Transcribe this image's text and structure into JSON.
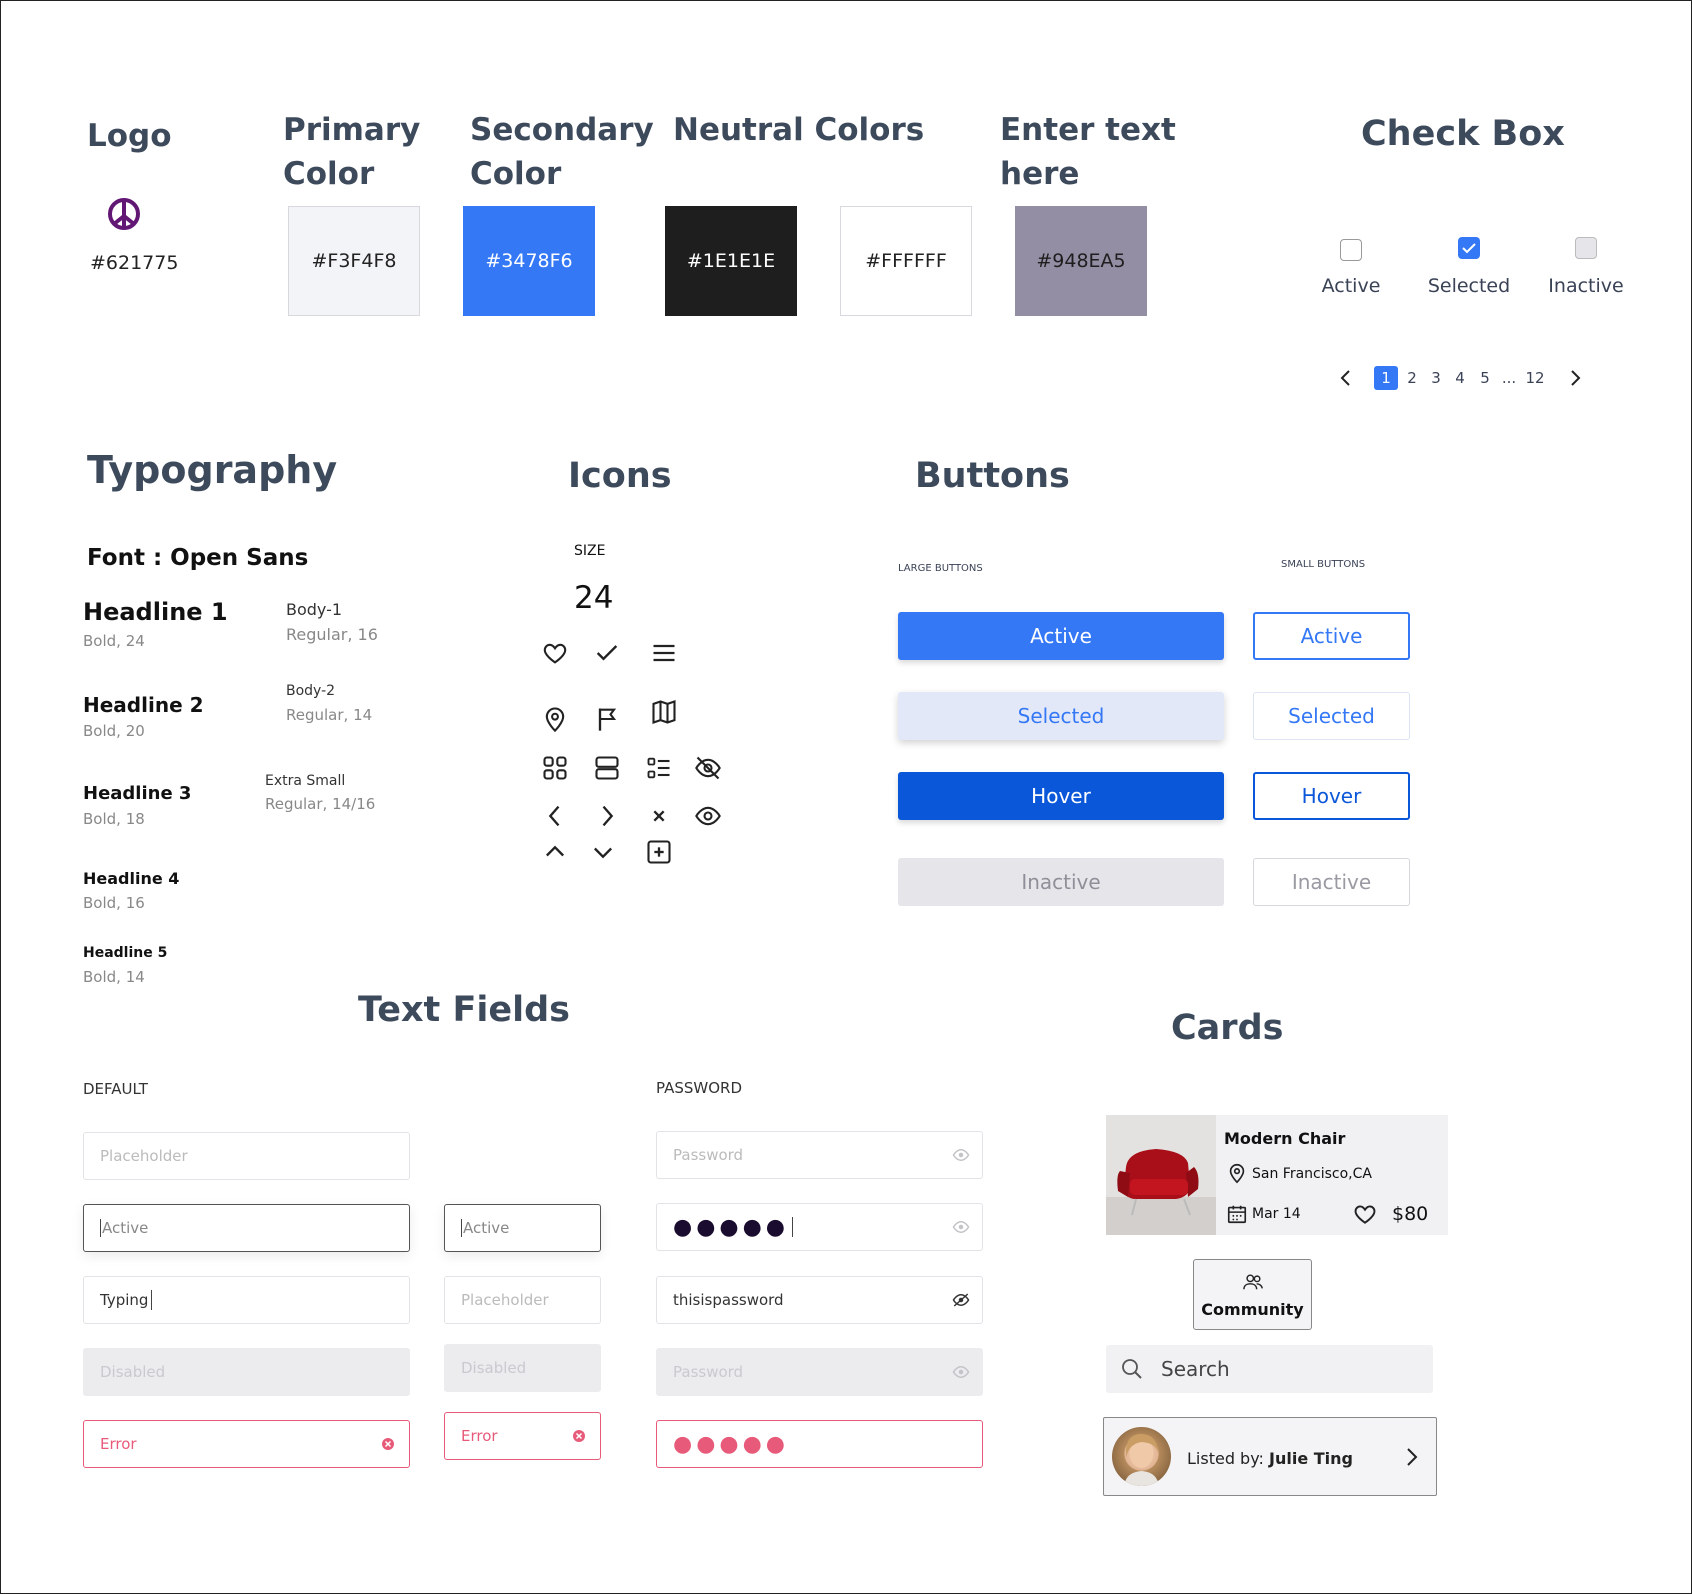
{
  "colors": {
    "logo": "#621775",
    "primary": "#F3F4F8",
    "secondary": "#3478F6",
    "neutral_dark": "#1E1E1E",
    "neutral_light": "#FFFFFF",
    "muted": "#948EA5",
    "button_hover": "#0B57D9",
    "button_selected_bg": "#E3E8F8",
    "error": "#E85A7A"
  },
  "logo": {
    "title": "Logo",
    "icon": "peace-icon",
    "hex": "#621775"
  },
  "primary": {
    "title_line1": "Primary",
    "title_line2": "Color",
    "hex": "#F3F4F8"
  },
  "secondary": {
    "title_line1": "Secondary",
    "title_line2": "Color",
    "hex": "#3478F6"
  },
  "neutral": {
    "title": "Neutral Colors",
    "hex_dark": "#1E1E1E",
    "hex_light": "#FFFFFF"
  },
  "extra": {
    "title_line1": "Enter text",
    "title_line2": "here",
    "hex": "#948EA5"
  },
  "checkbox": {
    "title": "Check Box",
    "items": [
      {
        "label": "Active"
      },
      {
        "label": "Selected"
      },
      {
        "label": "Inactive"
      }
    ]
  },
  "pagination": {
    "pages": [
      "1",
      "2",
      "3",
      "4",
      "5"
    ],
    "ellipsis": "...",
    "last": "12",
    "current": "1"
  },
  "typography": {
    "title": "Typography",
    "font": "Font : Open Sans",
    "headlines": [
      {
        "name": "Headline 1",
        "spec": "Bold, 24"
      },
      {
        "name": "Headline 2",
        "spec": "Bold, 20"
      },
      {
        "name": "Headline 3",
        "spec": "Bold, 18"
      },
      {
        "name": "Headline 4",
        "spec": "Bold, 16"
      },
      {
        "name": "Headline 5",
        "spec": "Bold, 14"
      }
    ],
    "bodies": [
      {
        "name": "Body-1",
        "spec": "Regular, 16"
      },
      {
        "name": "Body-2",
        "spec": "Regular, 14"
      },
      {
        "name": "Extra Small",
        "spec": "Regular, 14/16"
      }
    ]
  },
  "icons": {
    "title": "Icons",
    "size_label": "SIZE",
    "size_value": "24",
    "names": [
      "heart-icon",
      "check-icon",
      "menu-icon",
      "location-pin-icon",
      "flag-icon",
      "map-icon",
      "grid-icon",
      "rows-icon",
      "list-icon",
      "eye-off-icon",
      "chevron-left-icon",
      "chevron-right-icon",
      "close-icon",
      "eye-icon",
      "chevron-up-icon",
      "chevron-down-icon",
      "plus-square-icon"
    ]
  },
  "buttons": {
    "title": "Buttons",
    "large_label": "LARGE BUTTONS",
    "small_label": "SMALL BUTTONS",
    "states": [
      "Active",
      "Selected",
      "Hover",
      "Inactive"
    ]
  },
  "text_fields": {
    "title": "Text Fields",
    "default_label": "DEFAULT",
    "password_label": "PASSWORD",
    "placeholder": "Placeholder",
    "active": "Active",
    "typing": "Typing",
    "disabled": "Disabled",
    "error": "Error",
    "password_placeholder": "Password",
    "password_masked": "●●●●●",
    "password_visible": "thisispassword"
  },
  "cards": {
    "title": "Cards",
    "product": {
      "name": "Modern Chair",
      "location": "San Francisco,CA",
      "date": "Mar 14",
      "price": "$80"
    },
    "community": {
      "label": "Community"
    },
    "search": {
      "placeholder": "Search"
    },
    "listed": {
      "prefix": "Listed by:",
      "name": "Julie Ting"
    }
  }
}
